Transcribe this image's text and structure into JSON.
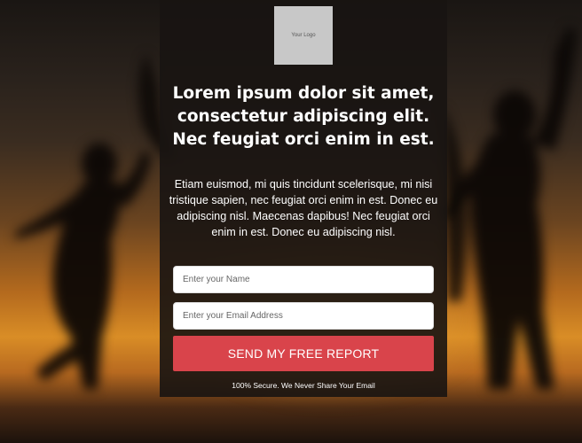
{
  "logo": {
    "text": "Your Logo"
  },
  "hero": {
    "headline": "Lorem ipsum dolor sit amet, consectetur adipiscing elit. Nec feugiat orci enim in est.",
    "body": "Etiam euismod, mi quis tincidunt scelerisque, mi nisi tristique sapien, nec feugiat orci enim in est. Donec eu adipiscing nisl. Maecenas dapibus! Nec feugiat orci enim in est. Donec eu adipiscing nisl."
  },
  "form": {
    "name_placeholder": "Enter your Name",
    "name_value": "",
    "email_placeholder": "Enter your Email Address",
    "email_value": "",
    "submit_label": "SEND MY FREE REPORT",
    "secure_note": "100% Secure. We Never Share Your Email"
  },
  "colors": {
    "button": "#d9444b",
    "panel": "#181412",
    "sunset": "#d98d26"
  }
}
